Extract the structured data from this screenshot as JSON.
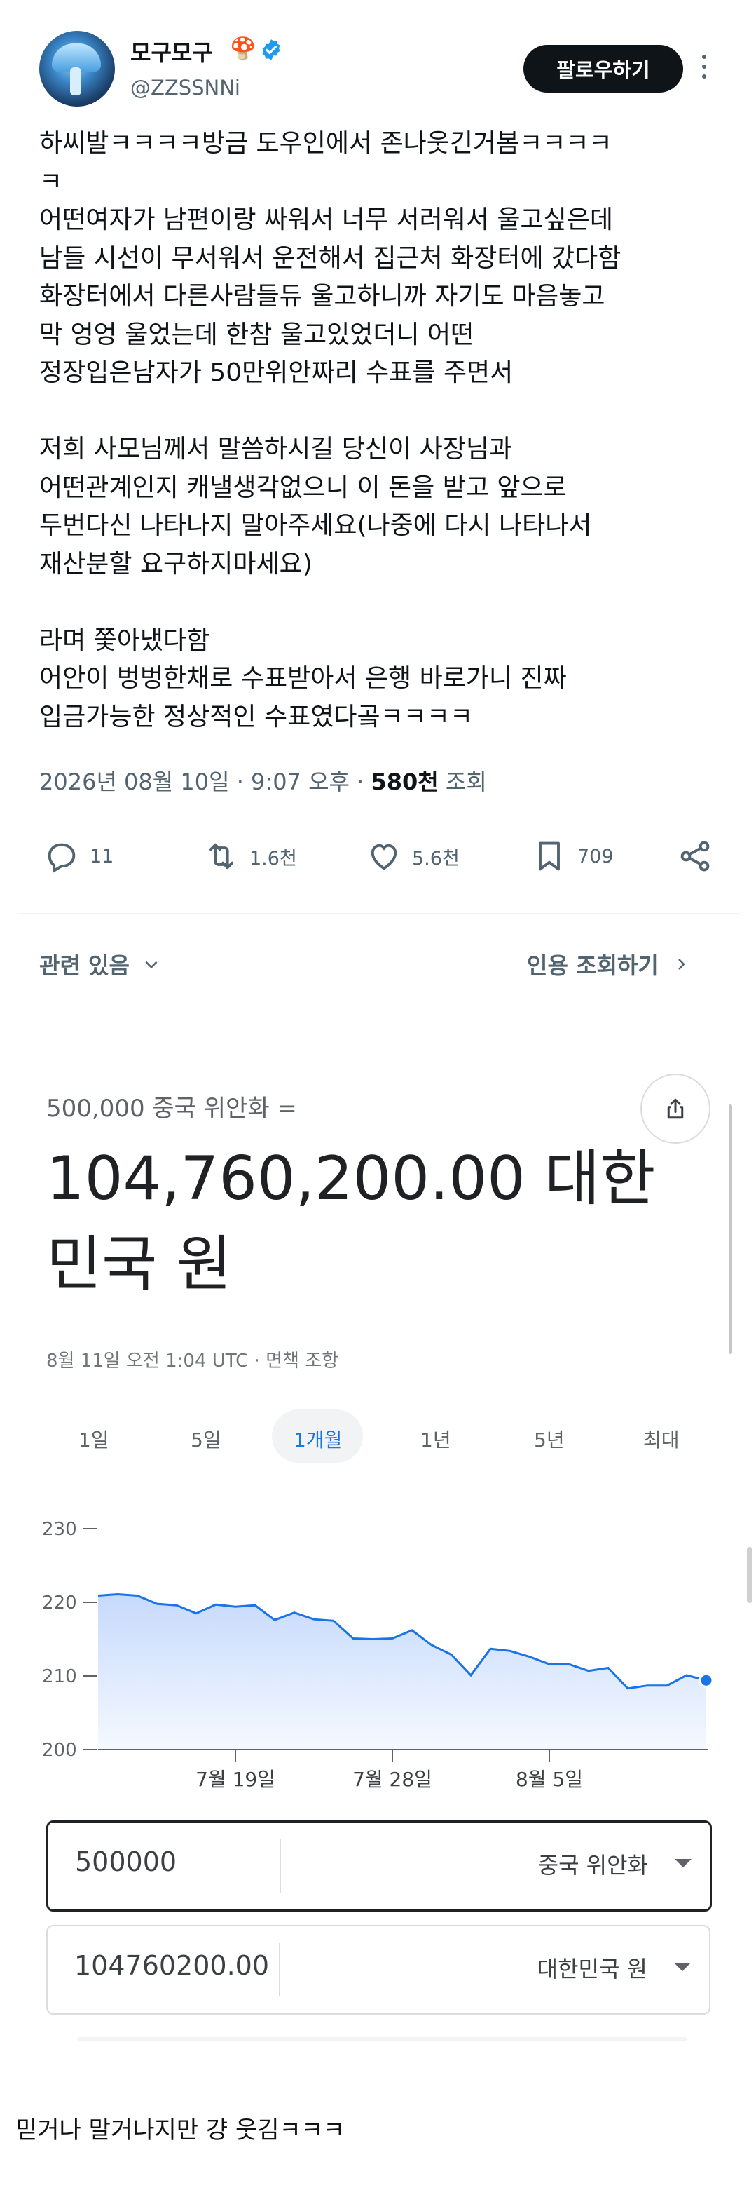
{
  "tweet": {
    "user_name": "모구모구",
    "name_emoji": "🍄",
    "handle": "@ZZSSNNi",
    "follow_label": "팔로우하기",
    "body": "하씨발ㅋㅋㅋㅋ방금 도우인에서 존나웃긴거봄ㅋㅋㅋㅋ\nㅋ\n어떤여자가 남편이랑 싸워서 너무 서러워서 울고싶은데\n남들 시선이 무서워서 운전해서 집근처 화장터에 갔다함\n화장터에서 다른사람들듀 울고하니까 자기도 마음놓고\n막 엉엉 울었는데 한참 울고있었더니 어떤\n정장입은남자가 50만위안짜리 수표를 주면서\n\n저희 사모님께서 말씀하시길 당신이 사장님과\n어떤관계인지 캐낼생각없으니 이 돈을 받고 앞으로\n두번다신 나타나지 말아주세요(나중에 다시 나타나서\n재산분할 요구하지마세요)\n\n라며 쫓아냈다함\n어안이 벙벙한채로 수표받아서 은행 바로가니 진짜\n입금가능한 정상적인 수표였다곸ㅋㅋㅋㅋ",
    "date": "2026년 08월 10일 · 9:07 오후",
    "views_count": "580천",
    "views_label": "조회",
    "actions": {
      "reply_count": "11",
      "retweet_count": "1.6천",
      "like_count": "5.6천",
      "bookmark_count": "709"
    },
    "related_label": "관련 있음",
    "quotes_label": "인용 조회하기"
  },
  "converter": {
    "from_text": "500,000 중국 위안화 =",
    "result_text": "104,760,200.00 대한민국 원",
    "update_time": "8월 11일 오전 1:04 UTC · 면책 조항",
    "ranges": [
      "1일",
      "5일",
      "1개월",
      "1년",
      "5년",
      "최대"
    ],
    "active_range": "1개월",
    "from_value": "500000",
    "from_currency": "중국 위안화",
    "to_value": "104760200.00",
    "to_currency": "대한민국 원",
    "colors": {
      "line": "#1a73e8",
      "fill": "#e8f0fe",
      "active": "#1a73e8"
    }
  },
  "chart_data": {
    "type": "area",
    "x_labels": [
      "7월 19일",
      "7월 28일",
      "8월 5일"
    ],
    "y_ticks": [
      230,
      220,
      210,
      200
    ],
    "ylim": [
      200,
      230
    ],
    "grid": false,
    "values": [
      220.9,
      221.1,
      220.9,
      219.8,
      219.6,
      218.5,
      219.7,
      219.4,
      219.6,
      217.6,
      218.6,
      217.7,
      217.5,
      215.1,
      215.0,
      215.1,
      216.2,
      214.2,
      212.9,
      210.1,
      213.7,
      213.4,
      212.6,
      211.6,
      211.6,
      210.7,
      211.1,
      208.3,
      208.7,
      208.7,
      210.1,
      209.4
    ]
  },
  "caption": "믿거나 말거나지만 걍 웃김ㅋㅋㅋ"
}
